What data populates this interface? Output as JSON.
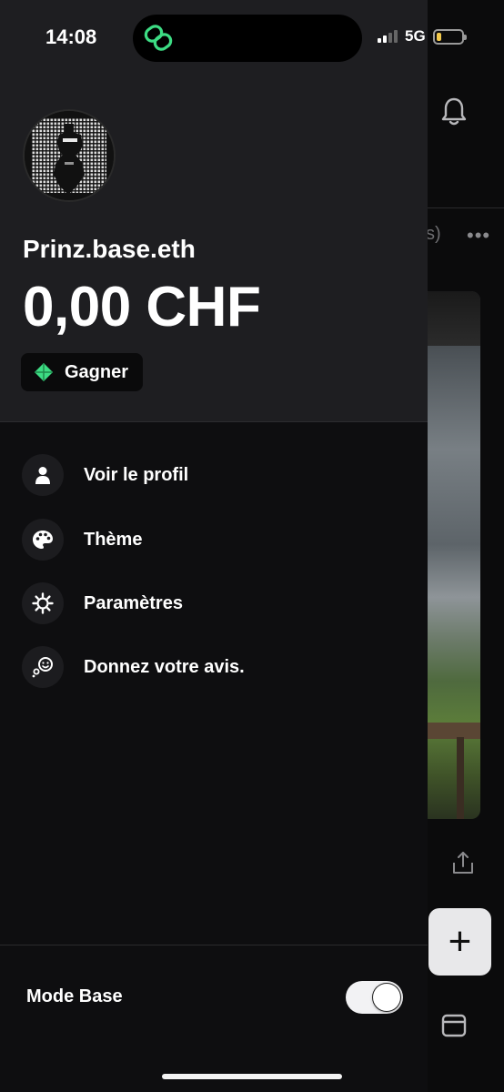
{
  "status_bar": {
    "time": "14:08",
    "network": "5G",
    "battery_level": 0.2,
    "battery_color": "#f2c94c",
    "island_icon": "link-chain-icon",
    "island_icon_color": "#3ddc84"
  },
  "background_app": {
    "partial_tab_text": "s)",
    "more_icon": "more-dots-icon",
    "bell_icon": "bell-icon",
    "share_icon": "share-icon",
    "fab_label": "+",
    "tab_icon": "window-icon"
  },
  "drawer": {
    "avatar_icon": "pixel-avatar-icon",
    "username": "Prinz.base.eth",
    "balance": "0,00 CHF",
    "earn_button": {
      "label": "Gagner",
      "icon": "diamond-icon",
      "icon_color": "#3ddc84"
    },
    "menu": [
      {
        "label": "Voir le profil",
        "icon": "person-icon"
      },
      {
        "label": "Thème",
        "icon": "palette-icon"
      },
      {
        "label": "Paramètres",
        "icon": "gear-icon"
      },
      {
        "label": "Donnez votre avis.",
        "icon": "feedback-icon"
      }
    ],
    "mode": {
      "label": "Mode Base",
      "enabled": true
    }
  }
}
